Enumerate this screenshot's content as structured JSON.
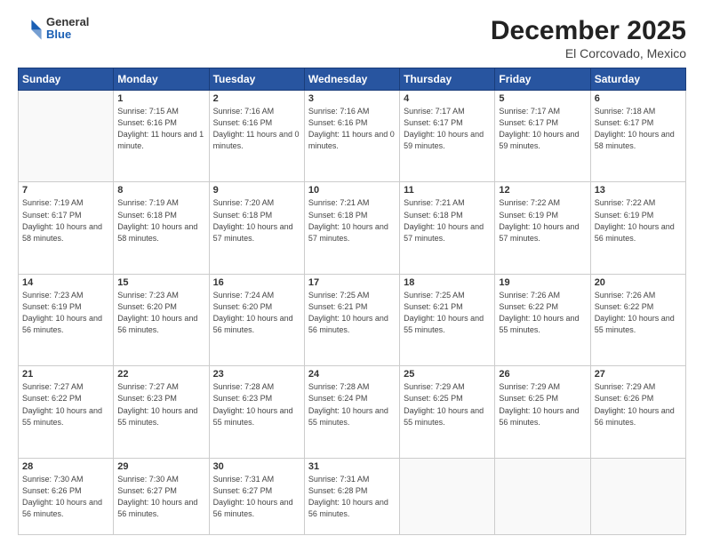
{
  "header": {
    "logo": {
      "general": "General",
      "blue": "Blue"
    },
    "title": "December 2025",
    "subtitle": "El Corcovado, Mexico"
  },
  "days_of_week": [
    "Sunday",
    "Monday",
    "Tuesday",
    "Wednesday",
    "Thursday",
    "Friday",
    "Saturday"
  ],
  "weeks": [
    [
      {
        "num": "",
        "empty": true
      },
      {
        "num": "1",
        "sunrise": "7:15 AM",
        "sunset": "6:16 PM",
        "daylight": "11 hours and 1 minute."
      },
      {
        "num": "2",
        "sunrise": "7:16 AM",
        "sunset": "6:16 PM",
        "daylight": "11 hours and 0 minutes."
      },
      {
        "num": "3",
        "sunrise": "7:16 AM",
        "sunset": "6:16 PM",
        "daylight": "11 hours and 0 minutes."
      },
      {
        "num": "4",
        "sunrise": "7:17 AM",
        "sunset": "6:17 PM",
        "daylight": "10 hours and 59 minutes."
      },
      {
        "num": "5",
        "sunrise": "7:17 AM",
        "sunset": "6:17 PM",
        "daylight": "10 hours and 59 minutes."
      },
      {
        "num": "6",
        "sunrise": "7:18 AM",
        "sunset": "6:17 PM",
        "daylight": "10 hours and 58 minutes."
      }
    ],
    [
      {
        "num": "7",
        "sunrise": "7:19 AM",
        "sunset": "6:17 PM",
        "daylight": "10 hours and 58 minutes."
      },
      {
        "num": "8",
        "sunrise": "7:19 AM",
        "sunset": "6:18 PM",
        "daylight": "10 hours and 58 minutes."
      },
      {
        "num": "9",
        "sunrise": "7:20 AM",
        "sunset": "6:18 PM",
        "daylight": "10 hours and 57 minutes."
      },
      {
        "num": "10",
        "sunrise": "7:21 AM",
        "sunset": "6:18 PM",
        "daylight": "10 hours and 57 minutes."
      },
      {
        "num": "11",
        "sunrise": "7:21 AM",
        "sunset": "6:18 PM",
        "daylight": "10 hours and 57 minutes."
      },
      {
        "num": "12",
        "sunrise": "7:22 AM",
        "sunset": "6:19 PM",
        "daylight": "10 hours and 57 minutes."
      },
      {
        "num": "13",
        "sunrise": "7:22 AM",
        "sunset": "6:19 PM",
        "daylight": "10 hours and 56 minutes."
      }
    ],
    [
      {
        "num": "14",
        "sunrise": "7:23 AM",
        "sunset": "6:19 PM",
        "daylight": "10 hours and 56 minutes."
      },
      {
        "num": "15",
        "sunrise": "7:23 AM",
        "sunset": "6:20 PM",
        "daylight": "10 hours and 56 minutes."
      },
      {
        "num": "16",
        "sunrise": "7:24 AM",
        "sunset": "6:20 PM",
        "daylight": "10 hours and 56 minutes."
      },
      {
        "num": "17",
        "sunrise": "7:25 AM",
        "sunset": "6:21 PM",
        "daylight": "10 hours and 56 minutes."
      },
      {
        "num": "18",
        "sunrise": "7:25 AM",
        "sunset": "6:21 PM",
        "daylight": "10 hours and 55 minutes."
      },
      {
        "num": "19",
        "sunrise": "7:26 AM",
        "sunset": "6:22 PM",
        "daylight": "10 hours and 55 minutes."
      },
      {
        "num": "20",
        "sunrise": "7:26 AM",
        "sunset": "6:22 PM",
        "daylight": "10 hours and 55 minutes."
      }
    ],
    [
      {
        "num": "21",
        "sunrise": "7:27 AM",
        "sunset": "6:22 PM",
        "daylight": "10 hours and 55 minutes."
      },
      {
        "num": "22",
        "sunrise": "7:27 AM",
        "sunset": "6:23 PM",
        "daylight": "10 hours and 55 minutes."
      },
      {
        "num": "23",
        "sunrise": "7:28 AM",
        "sunset": "6:23 PM",
        "daylight": "10 hours and 55 minutes."
      },
      {
        "num": "24",
        "sunrise": "7:28 AM",
        "sunset": "6:24 PM",
        "daylight": "10 hours and 55 minutes."
      },
      {
        "num": "25",
        "sunrise": "7:29 AM",
        "sunset": "6:25 PM",
        "daylight": "10 hours and 55 minutes."
      },
      {
        "num": "26",
        "sunrise": "7:29 AM",
        "sunset": "6:25 PM",
        "daylight": "10 hours and 56 minutes."
      },
      {
        "num": "27",
        "sunrise": "7:29 AM",
        "sunset": "6:26 PM",
        "daylight": "10 hours and 56 minutes."
      }
    ],
    [
      {
        "num": "28",
        "sunrise": "7:30 AM",
        "sunset": "6:26 PM",
        "daylight": "10 hours and 56 minutes."
      },
      {
        "num": "29",
        "sunrise": "7:30 AM",
        "sunset": "6:27 PM",
        "daylight": "10 hours and 56 minutes."
      },
      {
        "num": "30",
        "sunrise": "7:31 AM",
        "sunset": "6:27 PM",
        "daylight": "10 hours and 56 minutes."
      },
      {
        "num": "31",
        "sunrise": "7:31 AM",
        "sunset": "6:28 PM",
        "daylight": "10 hours and 56 minutes."
      },
      {
        "num": "",
        "empty": true
      },
      {
        "num": "",
        "empty": true
      },
      {
        "num": "",
        "empty": true
      }
    ]
  ]
}
